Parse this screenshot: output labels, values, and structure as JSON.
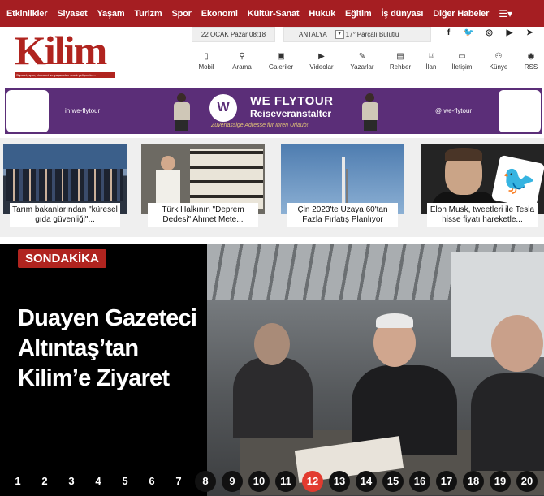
{
  "topnav": {
    "items": [
      "Etkinlikler",
      "Siyaset",
      "Yaşam",
      "Turizm",
      "Spor",
      "Ekonomi",
      "Kültür-Sanat",
      "Hukuk",
      "Eğitim",
      "İş dünyası",
      "Diğer Habeler"
    ]
  },
  "logo": {
    "text": "Kilim",
    "tagline": "Siyaset, spor, ekonomi ve yaşamdan sıcak gelişmeler..."
  },
  "header": {
    "date": "22 OCAK Pazar 08:18",
    "city": "ANTALYA",
    "temperature": "17°",
    "condition": "Parçalı Bulutlu"
  },
  "quick_links": [
    "Mobil",
    "Arama",
    "Galeriler",
    "Videolar",
    "Yazarlar",
    "Rehber",
    "İlan",
    "İletişim",
    "Künye",
    "RSS"
  ],
  "banner": {
    "handle_left": "in we-flytour",
    "handle_right": "@ we-flytour",
    "brand": "WE FLYTOUR",
    "brand_sub": "Reiseveranstalter",
    "slogan": "Zuverlässige Adresse für Ihren Urlaub!"
  },
  "news_cards": [
    {
      "caption": "Tarım bakanlarından \"küresel gıda güvenliği\"..."
    },
    {
      "caption": "Türk Halkının \"Deprem Dedesi\" Ahmet Mete..."
    },
    {
      "caption": "Çin 2023'te Uzaya 60'tan Fazla Fırlatış Planlıyor"
    },
    {
      "caption": "Elon Musk, tweetleri ile Tesla hisse fiyatı hareketle..."
    }
  ],
  "hero": {
    "badge": "SONDAKİKA",
    "headline": "Duayen Gazeteci Altıntaş’tan Kilim’e Ziyaret"
  },
  "pager": {
    "pages": [
      "1",
      "2",
      "3",
      "4",
      "5",
      "6",
      "7",
      "8",
      "9",
      "10",
      "11",
      "12",
      "13",
      "14",
      "15",
      "16",
      "17",
      "18",
      "19",
      "20"
    ],
    "active": "12"
  },
  "colors": {
    "brand_red": "#a51e22",
    "banner_purple": "#5b2e78",
    "active_page": "#e23b2f"
  }
}
